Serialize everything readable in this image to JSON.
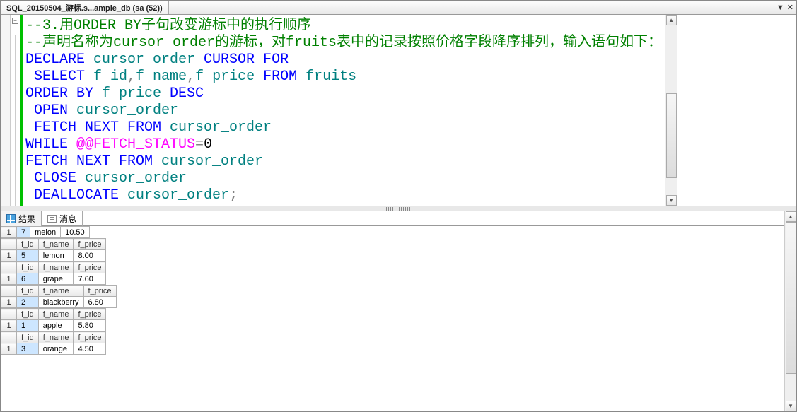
{
  "tab": {
    "title": "SQL_20150504_游标.s...ample_db (sa (52))"
  },
  "code": {
    "l1": {
      "a": "--3.用",
      "b": "ORDER BY",
      "c": "子句改变游标中的执行顺序"
    },
    "l2": {
      "a": "--声明名称为",
      "b": "cursor_order",
      "c": "的游标，对",
      "d": "fruits",
      "e": "表中的记录按照价格字段降序排列，输入语句如下："
    },
    "l3": {
      "a": "DECLARE",
      "b": " cursor_order ",
      "c": "CURSOR FOR"
    },
    "l4": {
      "a": " SELECT",
      "b": " f_id",
      "c": ",",
      "d": "f_name",
      "e": ",",
      "f": "f_price ",
      "g": "FROM",
      "h": " fruits"
    },
    "l5": {
      "a": "ORDER BY",
      "b": " f_price ",
      "c": "DESC"
    },
    "l6": {
      "a": " OPEN",
      "b": " cursor_order"
    },
    "l7": {
      "a": " FETCH NEXT FROM",
      "b": " cursor_order"
    },
    "l8": {
      "a": "WHILE ",
      "b": "@@FETCH_STATUS",
      "c": "=",
      "d": "0"
    },
    "l9": {
      "a": "FETCH NEXT FROM",
      "b": " cursor_order"
    },
    "l10": {
      "a": " CLOSE",
      "b": " cursor_order"
    },
    "l11": {
      "a": " DEALLOCATE",
      "b": " cursor_order",
      "c": ";"
    }
  },
  "result_tabs": {
    "results": "结果",
    "messages": "消息"
  },
  "headers": {
    "fid": "f_id",
    "fname": "f_name",
    "fprice": "f_price",
    "row1": "1"
  },
  "grids": [
    {
      "headers": false,
      "rownum": "1",
      "fid": "7",
      "fname": "melon",
      "fprice": "10.50"
    },
    {
      "headers": true,
      "rownum": "1",
      "fid": "5",
      "fname": "lemon",
      "fprice": "8.00"
    },
    {
      "headers": true,
      "rownum": "1",
      "fid": "6",
      "fname": "grape",
      "fprice": "7.60"
    },
    {
      "headers": true,
      "rownum": "1",
      "fid": "2",
      "fname": "blackberry",
      "fprice": "6.80"
    },
    {
      "headers": true,
      "rownum": "1",
      "fid": "1",
      "fname": "apple",
      "fprice": "5.80"
    },
    {
      "headers": true,
      "rownum": "1",
      "fid": "3",
      "fname": "orange",
      "fprice": "4.50"
    }
  ]
}
